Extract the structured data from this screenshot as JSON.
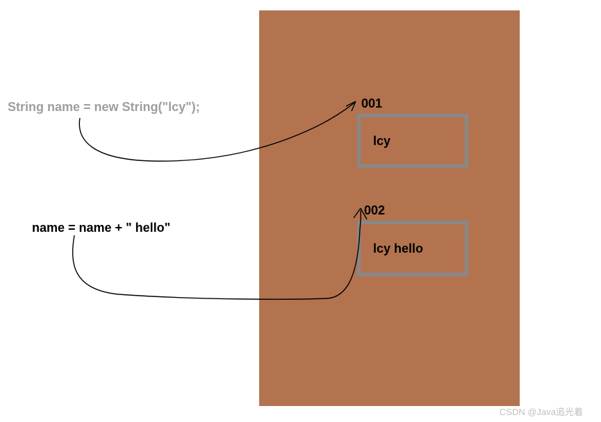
{
  "code": {
    "line1": "String name = new String(\"lcy\");",
    "line2": "name = name + \" hello\""
  },
  "heap": {
    "objects": [
      {
        "address": "001",
        "value": "lcy"
      },
      {
        "address": "002",
        "value": "lcy  hello"
      }
    ]
  },
  "watermark": "CSDN @Java追光着",
  "colors": {
    "heap_bg": "#b3734f",
    "box_border": "#888888",
    "grey_text": "#9e9e9e"
  }
}
